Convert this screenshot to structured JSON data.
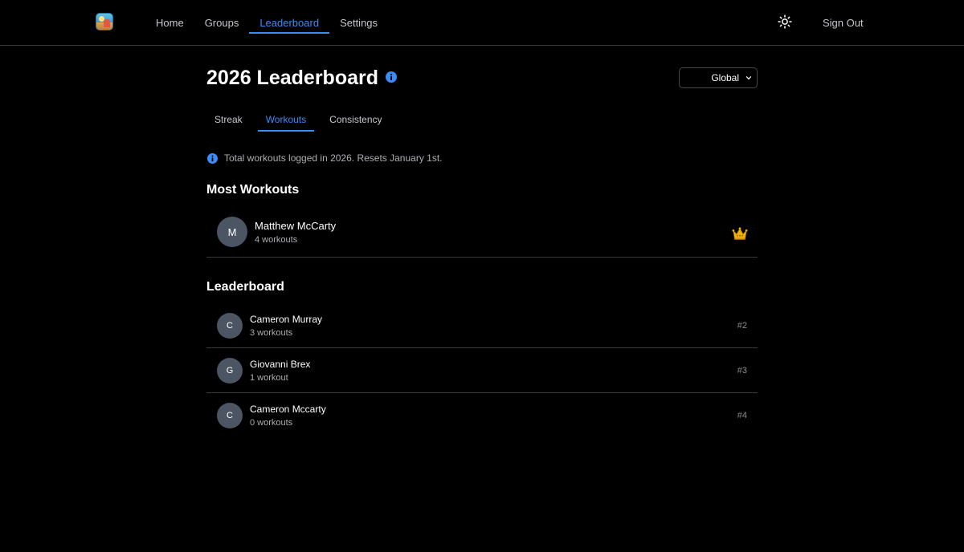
{
  "nav": {
    "links": [
      {
        "label": "Home",
        "active": false
      },
      {
        "label": "Groups",
        "active": false
      },
      {
        "label": "Leaderboard",
        "active": true
      },
      {
        "label": "Settings",
        "active": false
      }
    ],
    "sign_out": "Sign Out",
    "theme_icon": "sun-icon"
  },
  "page": {
    "title": "2026 Leaderboard",
    "scope_select": {
      "selected": "Global"
    },
    "tabs": [
      {
        "label": "Streak",
        "active": false
      },
      {
        "label": "Workouts",
        "active": true
      },
      {
        "label": "Consistency",
        "active": false
      }
    ],
    "info_note": "Total workouts logged in 2026. Resets January 1st."
  },
  "top": {
    "title": "Most Workouts",
    "leader": {
      "initial": "M",
      "name": "Matthew McCarty",
      "count": "4 workouts",
      "badge_icon": "crown-icon"
    }
  },
  "leaderboard": {
    "title": "Leaderboard",
    "rows": [
      {
        "initial": "C",
        "name": "Cameron Murray",
        "count": "3 workouts",
        "rank": "#2"
      },
      {
        "initial": "G",
        "name": "Giovanni Brex",
        "count": "1 workout",
        "rank": "#3"
      },
      {
        "initial": "C",
        "name": "Cameron Mccarty",
        "count": "0 workouts",
        "rank": "#4"
      }
    ]
  },
  "colors": {
    "background": "#000000",
    "accent": "#3b8cf5",
    "avatar": "#4b5563",
    "divider": "#3a3a3c"
  }
}
